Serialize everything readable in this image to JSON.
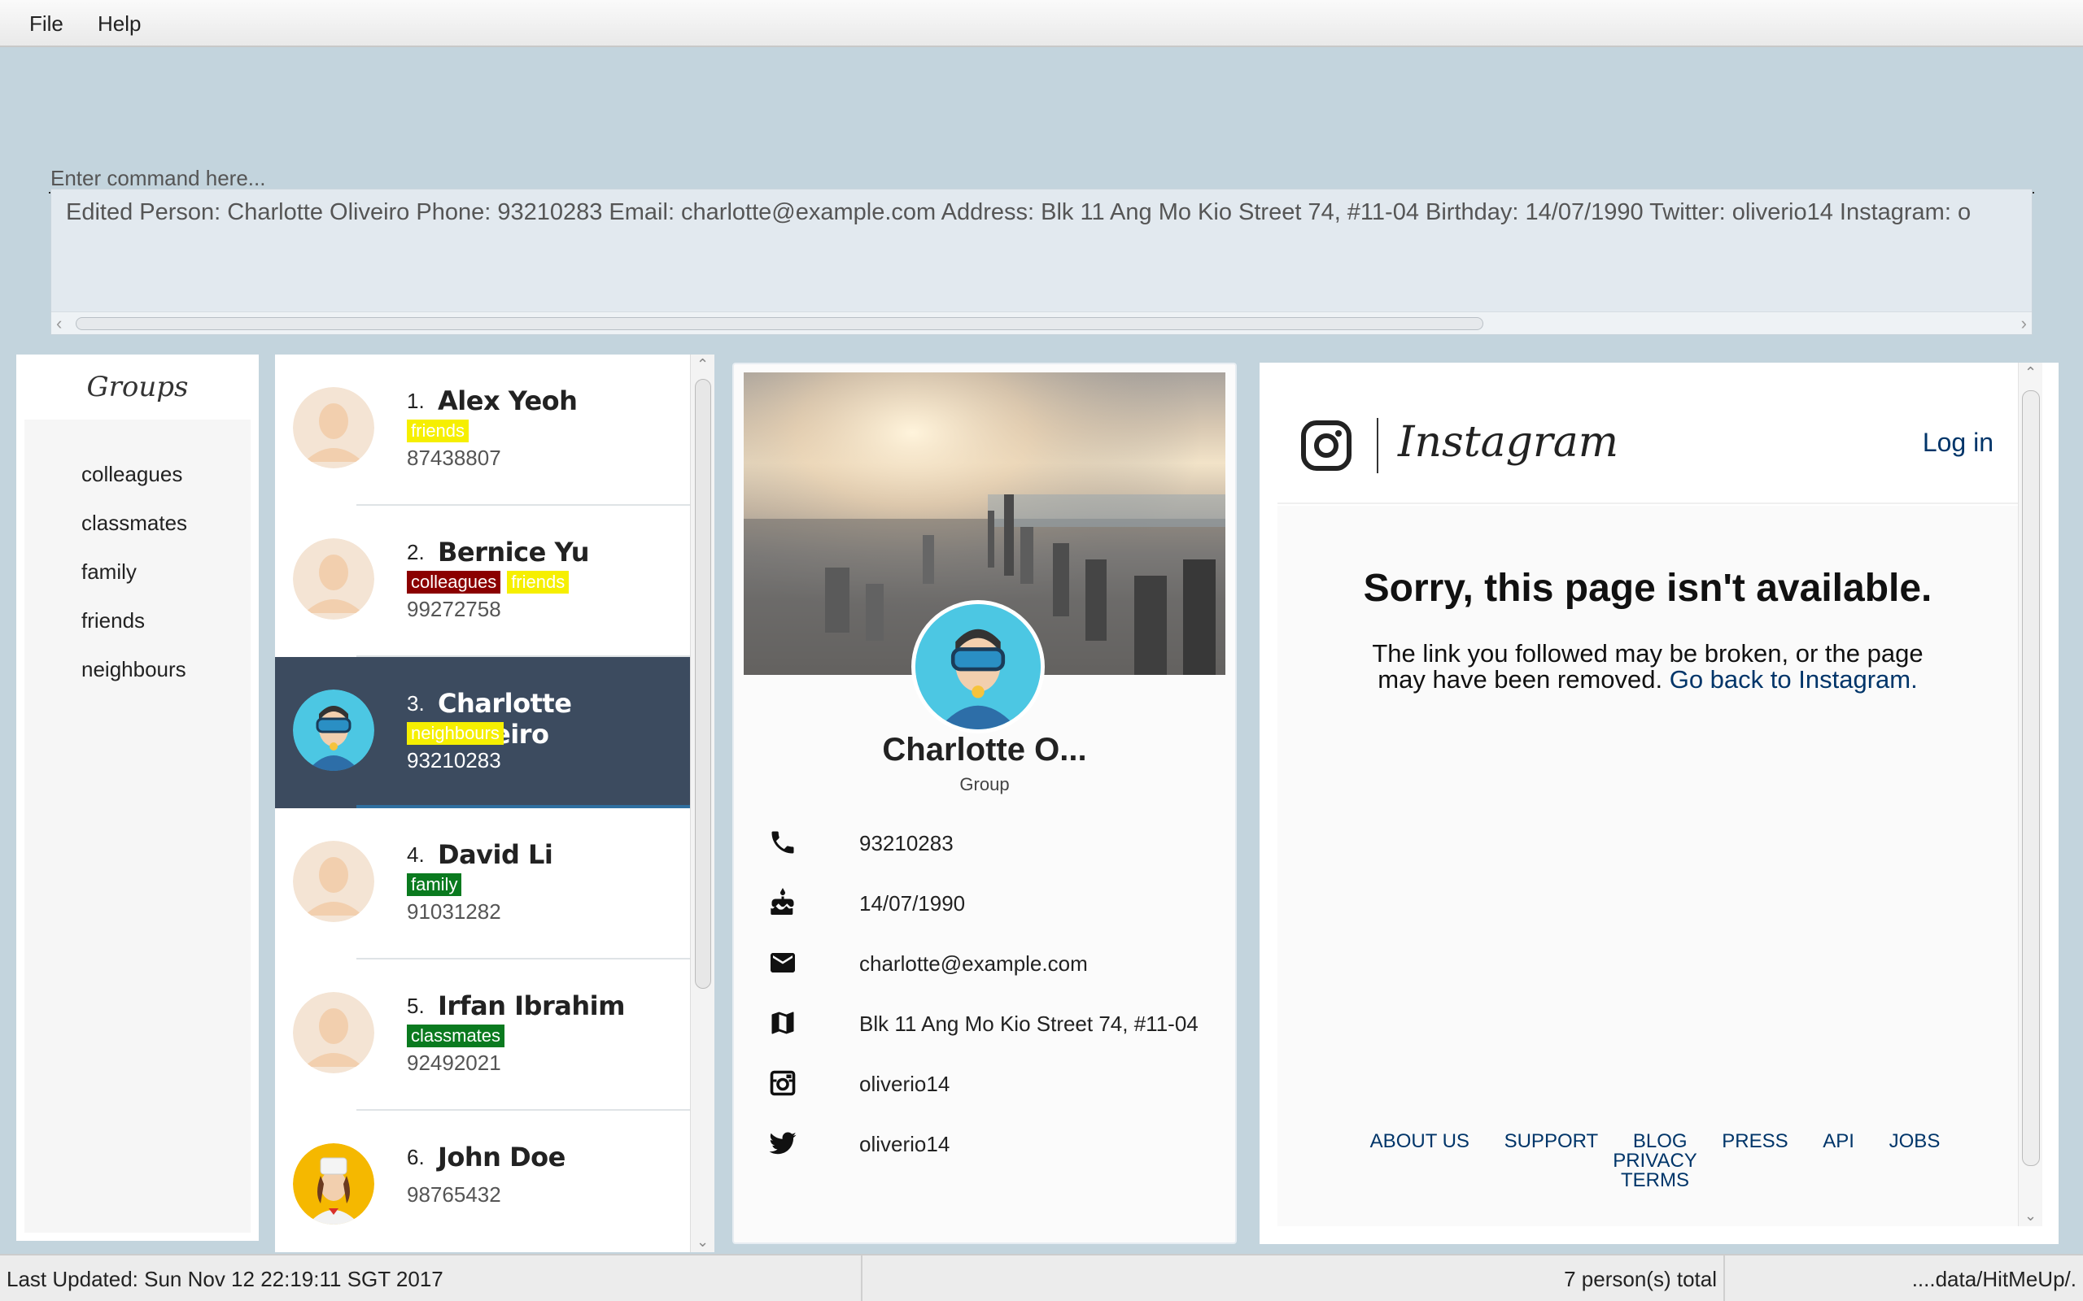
{
  "menu": {
    "file": "File",
    "help": "Help"
  },
  "command": {
    "placeholder": "Enter command here...",
    "result": "Edited Person: Charlotte Oliveiro Phone: 93210283 Email: charlotte@example.com Address: Blk 11 Ang Mo Kio Street 74, #11-04 Birthday: 14/07/1990 Twitter: oliverio14 Instagram: o"
  },
  "groups": {
    "title": "Groups",
    "items": [
      "colleagues",
      "classmates",
      "family",
      "friends",
      "neighbours"
    ]
  },
  "persons": [
    {
      "index": "1.",
      "name": "Alex Yeoh",
      "tags": [
        {
          "label": "friends",
          "color": "#f6ef00"
        }
      ],
      "phone": "87438807",
      "avatar": "default-avatar"
    },
    {
      "index": "2.",
      "name": "Bernice Yu",
      "tags": [
        {
          "label": "colleagues",
          "color": "#8b0000"
        },
        {
          "label": "friends",
          "color": "#f6ef00"
        }
      ],
      "phone": "99272758",
      "avatar": "default-avatar"
    },
    {
      "index": "3.",
      "name": "Charlotte Oliveiro",
      "tags": [
        {
          "label": "neighbours",
          "color": "#f6ef00"
        }
      ],
      "phone": "93210283",
      "avatar": "diver-avatar",
      "selected": true
    },
    {
      "index": "4.",
      "name": "David Li",
      "tags": [
        {
          "label": "family",
          "color": "#0a7a1f"
        }
      ],
      "phone": "91031282",
      "avatar": "default-avatar"
    },
    {
      "index": "5.",
      "name": "Irfan Ibrahim",
      "tags": [
        {
          "label": "classmates",
          "color": "#0a7a1f"
        }
      ],
      "phone": "92492021",
      "avatar": "default-avatar"
    },
    {
      "index": "6.",
      "name": "John Doe",
      "tags": [],
      "phone": "98765432",
      "avatar": "chef-avatar"
    }
  ],
  "profile": {
    "name": "Charlotte O...",
    "group": "Group",
    "phone": "93210283",
    "birthday": "14/07/1990",
    "email": "charlotte@example.com",
    "address": "Blk 11 Ang Mo Kio Street 74, #11-04",
    "instagram": "oliverio14",
    "twitter": "oliverio14"
  },
  "instagram": {
    "wordmark": "Instagram",
    "login": "Log in",
    "heading": "Sorry, this page isn't available.",
    "message": "The link you followed may be broken, or the page may have been removed.",
    "link": "Go back to Instagram.",
    "footer": [
      "ABOUT US",
      "SUPPORT",
      "BLOG",
      "PRESS",
      "API",
      "JOBS",
      "PRIVACY",
      "TERMS"
    ]
  },
  "status": {
    "last_updated": "Last Updated: Sun Nov 12 22:19:11 SGT 2017",
    "total": "7 person(s) total",
    "path": "....data/HitMeUp/."
  },
  "colors": {
    "selected_card": "#3c4b5f",
    "link": "#003569",
    "command_bg": "#c3d4dd"
  }
}
